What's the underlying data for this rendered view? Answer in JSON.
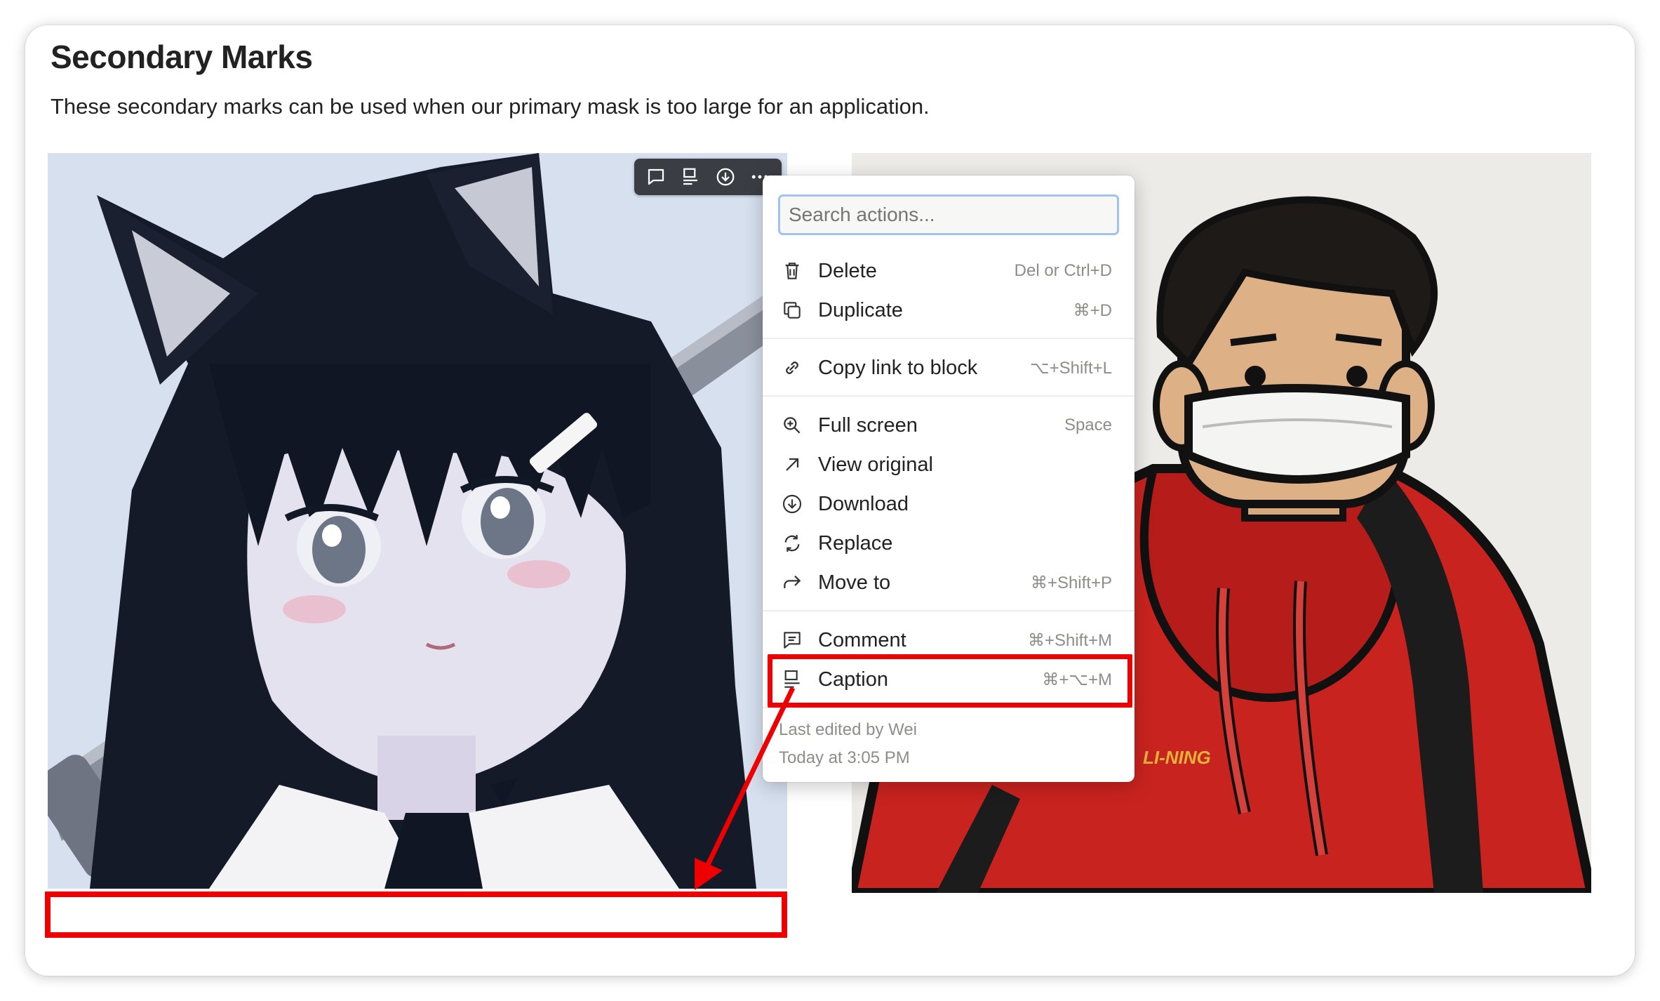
{
  "page": {
    "title": "Secondary Marks",
    "description": "These secondary marks can be used when our primary mask is too large for an application."
  },
  "images": {
    "left_alt": "",
    "right_alt": "",
    "right_logo_text": "LI-NING"
  },
  "toolbar": {
    "buttons": [
      "comment-icon",
      "caption-icon",
      "download-icon",
      "more-icon"
    ]
  },
  "menu": {
    "search": {
      "placeholder": "Search actions...",
      "value": ""
    },
    "items": [
      {
        "icon": "trash-icon",
        "label": "Delete",
        "shortcut": "Del or Ctrl+D"
      },
      {
        "icon": "duplicate-icon",
        "label": "Duplicate",
        "shortcut": "⌘+D"
      },
      {
        "icon": "link-icon",
        "label": "Copy link to block",
        "shortcut": "⌥+Shift+L"
      },
      {
        "icon": "zoom-icon",
        "label": "Full screen",
        "shortcut": "Space"
      },
      {
        "icon": "arrow-up-right-icon",
        "label": "View original",
        "shortcut": ""
      },
      {
        "icon": "download-icon",
        "label": "Download",
        "shortcut": ""
      },
      {
        "icon": "refresh-icon",
        "label": "Replace",
        "shortcut": ""
      },
      {
        "icon": "move-arrow-icon",
        "label": "Move to",
        "shortcut": "⌘+Shift+P"
      },
      {
        "icon": "comment-icon",
        "label": "Comment",
        "shortcut": "⌘+Shift+M"
      },
      {
        "icon": "caption-icon",
        "label": "Caption",
        "shortcut": "⌘+⌥+M"
      }
    ],
    "meta": {
      "edited_by": "Last edited by Wei",
      "edited_at": "Today at 3:05 PM"
    }
  },
  "colors": {
    "highlight": "#ee0000",
    "toolbar_bg": "#3a3d44",
    "search_border": "#9fc3ee"
  }
}
